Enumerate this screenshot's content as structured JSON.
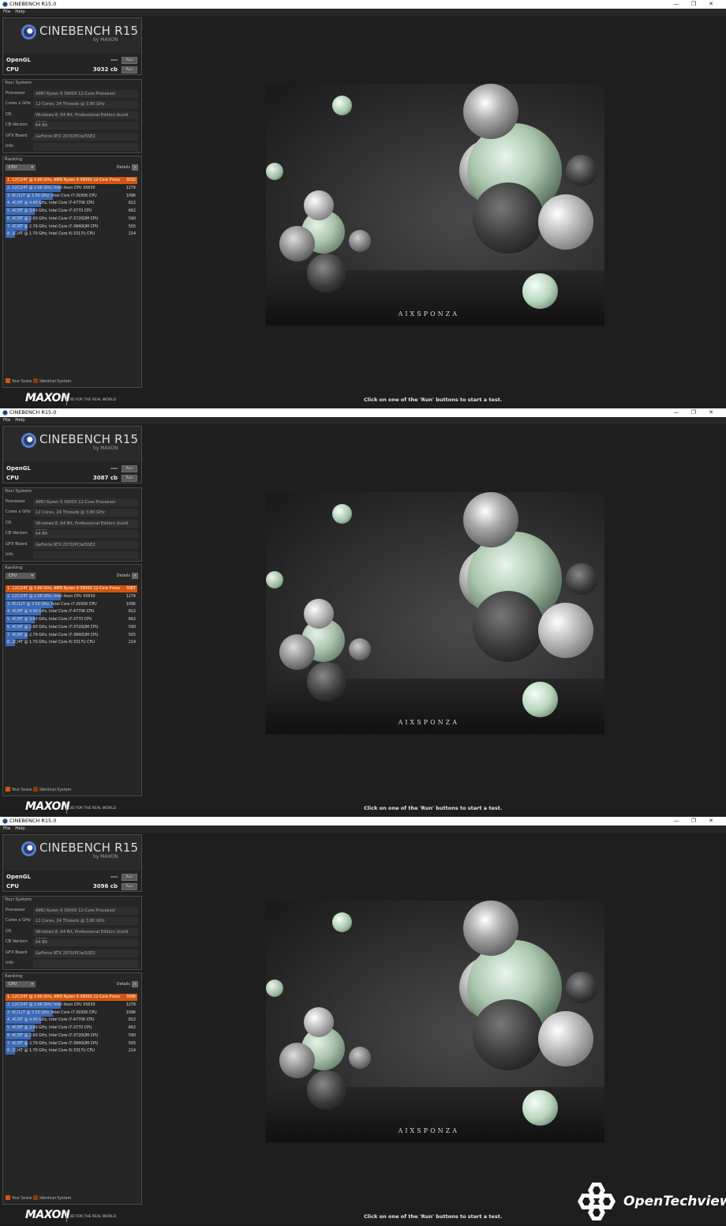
{
  "window": {
    "title": "CINEBENCH R15.0",
    "controls": [
      "—",
      "❐",
      "✕"
    ],
    "menu": [
      "File",
      "Help"
    ]
  },
  "logo": {
    "brand": "CINEBENCH R15",
    "sub": "by MAXON"
  },
  "labels": {
    "opengl": "OpenGL",
    "cpu": "CPU",
    "run": "Run",
    "opengl_value": "---",
    "your_system": "Your System",
    "ranking": "Ranking",
    "cpu_select": "CPU",
    "details": "Details",
    "details_btn": "»",
    "your_score": "Your Score",
    "identical_system": "Identical System",
    "maxon": "MAXON",
    "tagline": "3D FOR THE REAL WORLD",
    "hint": "Click on one of the 'Run' buttons to start a test.",
    "render_credit": "AIXSPONZA"
  },
  "system": [
    {
      "label": "Processor",
      "value": "AMD Ryzen 9 3900X 12-Core Processor"
    },
    {
      "label": "Cores x GHz",
      "value": "12 Cores, 24 Threads @ 3.80 GHz"
    },
    {
      "label": "OS",
      "value": "Windows 8, 64 Bit, Professional Edition (build 9200)"
    },
    {
      "label": "CB Version",
      "value": "64 Bit"
    },
    {
      "label": "GFX Board",
      "value": "GeForce RTX 2070/PCIe/SSE2"
    },
    {
      "label": "Info",
      "value": ""
    }
  ],
  "runs": [
    {
      "cpu_score": "3032 cb",
      "top_score": "3032",
      "top_label": "1. 12C/24T @ 3.80 GHz, AMD Ryzen 9 3900X 12-Core Proce"
    },
    {
      "cpu_score": "3087 cb",
      "top_score": "3087",
      "top_label": "1. 12C/24T @ 3.80 GHz, AMD Ryzen 9 3900X 12-Core Proce"
    },
    {
      "cpu_score": "3096 cb",
      "top_score": "3096",
      "top_label": "1. 12C/24T @ 3.80 GHz, AMD Ryzen 9 3900X 12-Core Proce"
    }
  ],
  "ranking_rows": [
    {
      "label": "2. 12C/24T @ 2.66 GHz, Intel Xeon CPU X5650",
      "score": "1279",
      "fill": 0.42
    },
    {
      "label": "3. 6C/12T @ 3.50 GHz, Intel Core i7-3930K CPU",
      "score": "1096",
      "fill": 0.36
    },
    {
      "label": "4. 4C/8T @ 4.40 GHz, Intel Core i7-4770K CPU",
      "score": "822",
      "fill": 0.27
    },
    {
      "label": "5. 4C/8T @ 3.40 GHz, Intel Core i7-3770 CPU",
      "score": "662",
      "fill": 0.22
    },
    {
      "label": "6. 4C/8T @ 2.60 GHz, Intel Core i7-3720QM CPU",
      "score": "590",
      "fill": 0.19
    },
    {
      "label": "7. 4C/8T @ 2.79 GHz, Intel Core i7-3840QM CPU",
      "score": "505",
      "fill": 0.17
    },
    {
      "label": "8. 2C/4T @ 1.70 GHz, Intel Core i5-3317U CPU",
      "score": "214",
      "fill": 0.07
    }
  ],
  "colors": {
    "your_score": "#d4550e",
    "identical": "#8a3a10",
    "bar": "#3a69b7"
  },
  "watermark": {
    "text": "OpenTechview"
  }
}
